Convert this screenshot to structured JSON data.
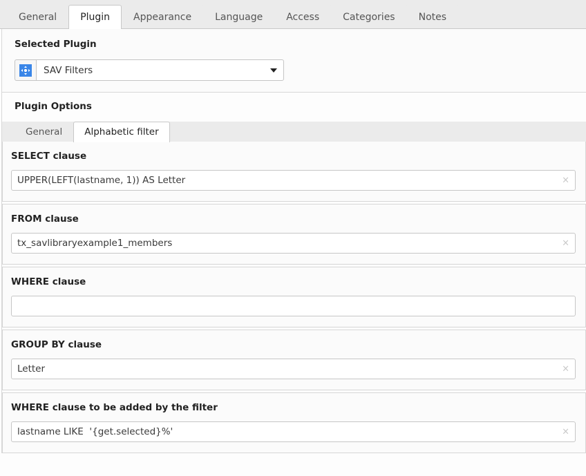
{
  "top_tabs": [
    {
      "label": "General",
      "active": false
    },
    {
      "label": "Plugin",
      "active": true
    },
    {
      "label": "Appearance",
      "active": false
    },
    {
      "label": "Language",
      "active": false
    },
    {
      "label": "Access",
      "active": false
    },
    {
      "label": "Categories",
      "active": false
    },
    {
      "label": "Notes",
      "active": false
    }
  ],
  "selected_plugin": {
    "section_title": "Selected Plugin",
    "icon_name": "move-arrows-icon",
    "value": "SAV Filters",
    "dropdown_icon": "chevron-down-icon"
  },
  "plugin_options": {
    "section_title": "Plugin Options",
    "tabs": [
      {
        "label": "General",
        "active": false
      },
      {
        "label": "Alphabetic filter",
        "active": true
      }
    ],
    "clauses": [
      {
        "label": "SELECT clause",
        "value": "UPPER(LEFT(lastname, 1)) AS Letter",
        "clear_icon": "×",
        "has_clear": true
      },
      {
        "label": "FROM clause",
        "value": "tx_savlibraryexample1_members",
        "clear_icon": "×",
        "has_clear": true
      },
      {
        "label": "WHERE clause",
        "value": "",
        "clear_icon": "",
        "has_clear": false
      },
      {
        "label": "GROUP BY clause",
        "value": "Letter",
        "clear_icon": "×",
        "has_clear": true
      },
      {
        "label": "WHERE clause to be added by the filter",
        "value": "lastname LIKE  '{get.selected}%'",
        "clear_icon": "×",
        "has_clear": true
      }
    ]
  },
  "colors": {
    "accent": "#3a86e8",
    "tab_bar_bg": "#ebebeb",
    "panel_bg": "#fbfbfb",
    "border": "#d6d6d6"
  }
}
